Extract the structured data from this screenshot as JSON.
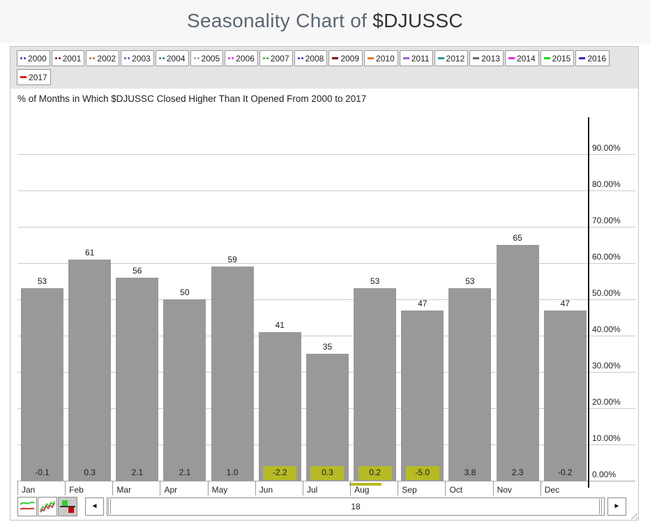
{
  "title": {
    "prefix": "Seasonality Chart of ",
    "symbol": "$DJUSSC"
  },
  "year_buttons": [
    {
      "label": "2000",
      "marker": "dots",
      "color": "#3333cc"
    },
    {
      "label": "2001",
      "marker": "dots",
      "color": "#990000"
    },
    {
      "label": "2002",
      "marker": "dots",
      "color": "#dd6622"
    },
    {
      "label": "2003",
      "marker": "dots",
      "color": "#8844bb"
    },
    {
      "label": "2004",
      "marker": "dots",
      "color": "#22808f"
    },
    {
      "label": "2005",
      "marker": "dots",
      "color": "#999999"
    },
    {
      "label": "2006",
      "marker": "dots",
      "color": "#ee22ee"
    },
    {
      "label": "2007",
      "marker": "dots",
      "color": "#22bb22"
    },
    {
      "label": "2008",
      "marker": "dots",
      "color": "#3333bb"
    },
    {
      "label": "2009",
      "marker": "dash",
      "color": "#880000"
    },
    {
      "label": "2010",
      "marker": "dash",
      "color": "#ee7722"
    },
    {
      "label": "2011",
      "marker": "dash",
      "color": "#9966dd"
    },
    {
      "label": "2012",
      "marker": "dash",
      "color": "#229999"
    },
    {
      "label": "2013",
      "marker": "dash",
      "color": "#666666"
    },
    {
      "label": "2014",
      "marker": "dash",
      "color": "#ee22ee"
    },
    {
      "label": "2015",
      "marker": "dash",
      "color": "#00dd00"
    },
    {
      "label": "2016",
      "marker": "dash",
      "color": "#3322cc"
    },
    {
      "label": "2017",
      "marker": "dash",
      "color": "#ee1111"
    }
  ],
  "chart_data": {
    "type": "bar",
    "title": "% of Months in Which $DJUSSC Closed Higher Than It Opened From 2000 to 2017",
    "categories": [
      "Jan",
      "Feb",
      "Mar",
      "Apr",
      "May",
      "Jun",
      "Jul",
      "Aug",
      "Sep",
      "Oct",
      "Nov",
      "Dec"
    ],
    "series": [
      {
        "name": "Percent of months closed higher",
        "values": [
          53,
          61,
          56,
          50,
          59,
          41,
          35,
          53,
          47,
          53,
          65,
          47
        ]
      },
      {
        "name": "Average monthly change",
        "values": [
          "-0.1",
          "0.3",
          "2.1",
          "2.1",
          "1.0",
          "-2.2",
          "0.3",
          "0.2",
          "-5.0",
          "3.8",
          "2.3",
          "-0.2"
        ]
      }
    ],
    "highlighted_categories": [
      "Jun",
      "Jul",
      "Aug",
      "Sep"
    ],
    "underlined_categories": [
      "Aug"
    ],
    "ylim": [
      0,
      100
    ],
    "ytick_labels": [
      "0.00%",
      "10.00%",
      "20.00%",
      "30.00%",
      "40.00%",
      "50.00%",
      "60.00%",
      "70.00%",
      "80.00%",
      "90.00%"
    ],
    "grid": true,
    "legend_position": "none",
    "bar_color": "#999999",
    "highlight_color": "#b6ba23"
  },
  "toolbar": {
    "left_arrow": "◄",
    "right_arrow": "►",
    "scrollbar_label": "18"
  }
}
